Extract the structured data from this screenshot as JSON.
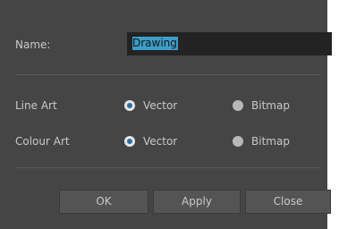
{
  "name_field": {
    "label": "Name:",
    "value": "Drawing"
  },
  "line_art": {
    "label": "Line Art",
    "options": [
      {
        "label": "Vector",
        "selected": true
      },
      {
        "label": "Bitmap",
        "selected": false
      }
    ]
  },
  "colour_art": {
    "label": "Colour Art",
    "options": [
      {
        "label": "Vector",
        "selected": true
      },
      {
        "label": "Bitmap",
        "selected": false
      }
    ]
  },
  "buttons": {
    "ok": "OK",
    "apply": "Apply",
    "close": "Close"
  },
  "colors": {
    "dialog_bg": "#454545",
    "input_bg": "#232323",
    "selection": "#3d9ec9",
    "radio_selected": "#2b6e9e"
  }
}
